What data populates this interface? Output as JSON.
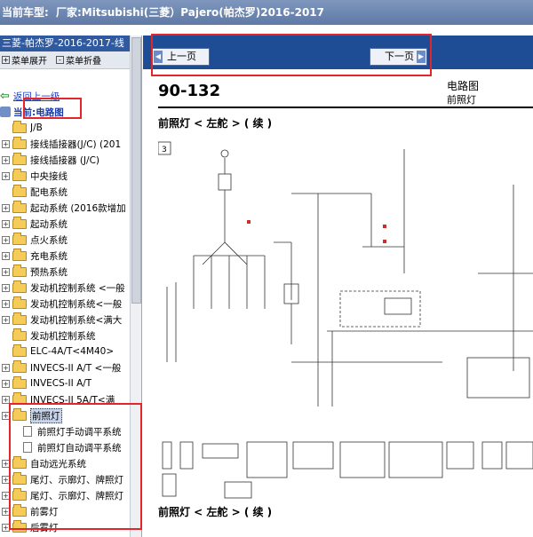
{
  "topbar": {
    "label": "当前车型:",
    "vehicle": "厂家:Mitsubishi(三菱）Pajero(帕杰罗)2016-2017"
  },
  "tree": {
    "header": "三菱-帕杰罗-2016-2017-线",
    "expand_all": "菜单展开",
    "collapse_all": "菜单折叠",
    "back": "返回上一级",
    "current_prefix": "当前:",
    "current": "电路图",
    "items": [
      {
        "label": "J/B",
        "expandable": false
      },
      {
        "label": "接线插接器(J/C) (201",
        "expandable": true
      },
      {
        "label": "接线插接器 (J/C)",
        "expandable": true
      },
      {
        "label": "中央接线",
        "expandable": true
      },
      {
        "label": "配电系统",
        "expandable": false
      },
      {
        "label": "起动系统 (2016款增加",
        "expandable": true
      },
      {
        "label": "起动系统",
        "expandable": true
      },
      {
        "label": "点火系统",
        "expandable": true
      },
      {
        "label": "充电系统",
        "expandable": true
      },
      {
        "label": "预热系统",
        "expandable": true
      },
      {
        "label": "发动机控制系统 <一般",
        "expandable": true
      },
      {
        "label": "发动机控制系统<一般",
        "expandable": true
      },
      {
        "label": "发动机控制系统<满大",
        "expandable": true
      },
      {
        "label": "发动机控制系统",
        "expandable": false
      },
      {
        "label": "ELC-4A/T<4M40>",
        "expandable": false
      },
      {
        "label": "INVECS-II A/T <一般",
        "expandable": true
      },
      {
        "label": "INVECS-II A/T",
        "expandable": true
      },
      {
        "label": "INVECS-II 5A/T<满",
        "expandable": true
      },
      {
        "label": "前照灯",
        "expandable": true,
        "selected": true
      },
      {
        "label": "前照灯手动调平系统",
        "expandable": false,
        "doc": true
      },
      {
        "label": "前照灯自动调平系统",
        "expandable": false,
        "doc": true
      },
      {
        "label": "自动远光系统",
        "expandable": true
      },
      {
        "label": "尾灯、示廓灯、牌照灯",
        "expandable": true
      },
      {
        "label": "尾灯、示廓灯、牌照灯",
        "expandable": true
      },
      {
        "label": "前雾灯",
        "expandable": true
      },
      {
        "label": "后雾灯",
        "expandable": true
      }
    ]
  },
  "nav": {
    "prev": "上一页",
    "next": "下一页"
  },
  "document": {
    "page_number": "90-132",
    "header_title": "电路图",
    "header_subtitle": "前照灯",
    "section_title": "前照灯 < 左舵 > ( 续 )",
    "section_title_2": "前照灯 < 左舵 > ( 续 )",
    "figure_number": "3"
  },
  "colors": {
    "topbar": "#5f79a6",
    "nav_bar": "#1e4d96",
    "annotation": "#e3262a",
    "tree_header": "#2f5aa0"
  }
}
